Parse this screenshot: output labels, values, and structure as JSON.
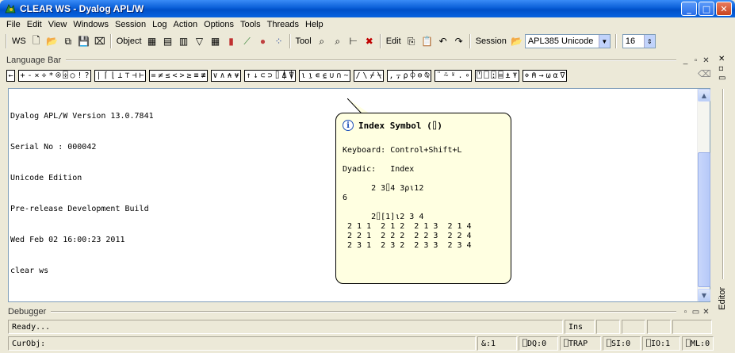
{
  "window": {
    "title": "CLEAR WS - Dyalog APL/W"
  },
  "menu": [
    "File",
    "Edit",
    "View",
    "Windows",
    "Session",
    "Log",
    "Action",
    "Options",
    "Tools",
    "Threads",
    "Help"
  ],
  "toolbar": {
    "ws_label": "WS",
    "object_label": "Object",
    "tool_label": "Tool",
    "edit_label": "Edit",
    "session_label": "Session",
    "font_value": "APL385 Unicode",
    "size_value": "16"
  },
  "language_bar": {
    "label": "Language Bar",
    "groups": [
      [
        "←"
      ],
      [
        "+",
        "-",
        "×",
        "÷",
        "*",
        "⍟",
        "⌹",
        "○",
        "!",
        "?"
      ],
      [
        "|",
        "⌈",
        "⌊",
        "⊥",
        "⊤",
        "⊣",
        "⊢"
      ],
      [
        "=",
        "≠",
        "≤",
        "<",
        ">",
        "≥",
        "≡",
        "≢"
      ],
      [
        "∨",
        "∧",
        "⍲",
        "⍱"
      ],
      [
        "↑",
        "↓",
        "⊂",
        "⊃",
        "⌷",
        "⍋",
        "⍒"
      ],
      [
        "⍳",
        "⍸",
        "∊",
        "⍷",
        "∪",
        "∩",
        "~"
      ],
      [
        "/",
        "\\",
        "⌿",
        "⍀"
      ],
      [
        ",",
        "⍪",
        "⍴",
        "⌽",
        "⊖",
        "⍉"
      ],
      [
        "¨",
        "⍨",
        "⍣",
        ".",
        "∘"
      ],
      [
        "⍞",
        "⎕",
        "⍠",
        "⌸",
        "⍎",
        "⍕"
      ],
      [
        "⋄",
        "⍝",
        "→",
        "⍵",
        "⍺",
        "∇"
      ]
    ]
  },
  "session": {
    "lines": [
      "Dyalog APL/W Version 13.0.7841",
      "Serial No : 000042",
      "Unicode Edition",
      "Pre-release Development Build",
      "Wed Feb 02 16:00:23 2011",
      "clear ws"
    ]
  },
  "tooltip": {
    "title": "Index Symbol (⌷)",
    "body": "Keyboard: Control+Shift+L\n\nDyadic:   Index\n\n      2 3⌷4 3⍴⍳12\n6\n\n      2⌷[1]⍳2 3 4\n 2 1 1  2 1 2  2 1 3  2 1 4\n 2 2 1  2 2 2  2 2 3  2 2 4\n 2 3 1  2 3 2  2 3 3  2 3 4"
  },
  "editor_label": "Editor",
  "debugger": {
    "label": "Debugger"
  },
  "status": {
    "ready": "Ready...",
    "ins": "Ins",
    "curobj": "CurObj:",
    "amp": "&:1",
    "dq": "⎕DQ:0",
    "trap": "⎕TRAP",
    "si": "⎕SI:0",
    "io": "⎕IO:1",
    "ml": "⎕ML:0"
  }
}
